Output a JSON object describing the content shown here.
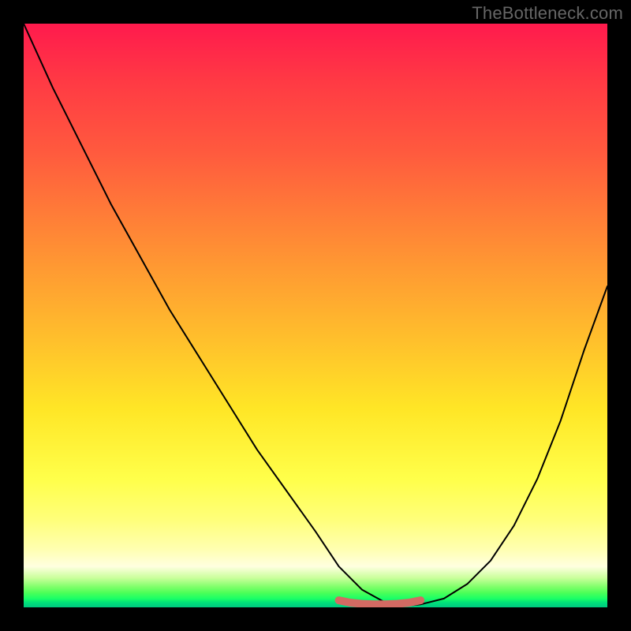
{
  "watermark": "TheBottleneck.com",
  "chart_data": {
    "type": "line",
    "title": "",
    "xlabel": "",
    "ylabel": "",
    "xlim": [
      0,
      100
    ],
    "ylim": [
      0,
      100
    ],
    "grid": false,
    "legend": false,
    "series": [
      {
        "name": "bottleneck-curve",
        "x": [
          0,
          5,
          10,
          15,
          20,
          25,
          30,
          35,
          40,
          45,
          50,
          54,
          58,
          62,
          66,
          68,
          72,
          76,
          80,
          84,
          88,
          92,
          96,
          100
        ],
        "values": [
          100,
          89,
          79,
          69,
          60,
          51,
          43,
          35,
          27,
          20,
          13,
          7,
          3,
          0.8,
          0.3,
          0.5,
          1.5,
          4,
          8,
          14,
          22,
          32,
          44,
          55
        ]
      }
    ],
    "highlight": {
      "name": "ideal-match-band",
      "color": "#d36a63",
      "x": [
        54,
        56,
        58,
        60,
        62,
        64,
        66,
        68
      ],
      "values": [
        1.2,
        0.8,
        0.6,
        0.5,
        0.5,
        0.6,
        0.8,
        1.2
      ]
    },
    "background_gradient": {
      "top_color": "#ff1a4d",
      "mid_color": "#ffe626",
      "bottom_color": "#00c980"
    }
  }
}
